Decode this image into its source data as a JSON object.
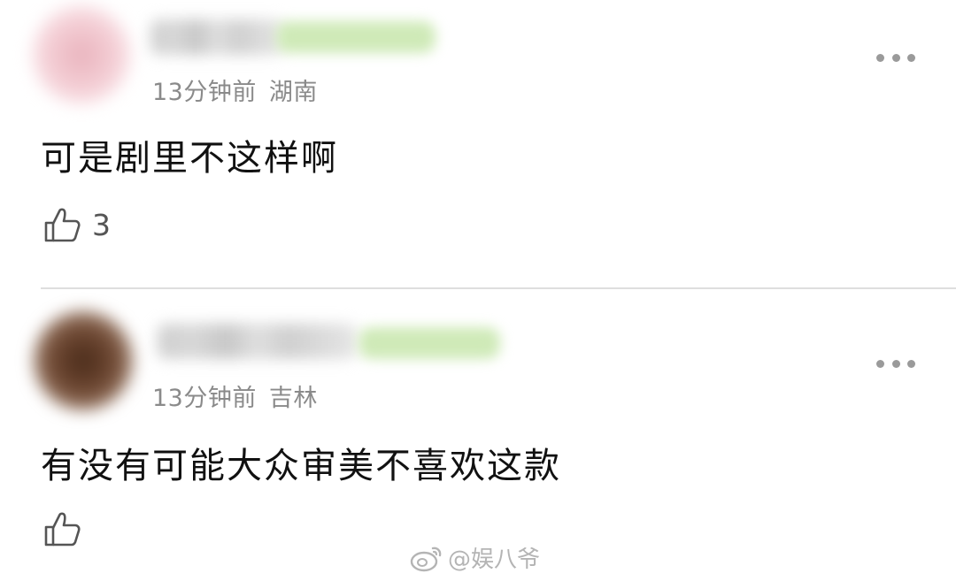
{
  "comments": [
    {
      "meta_time": "13分钟前",
      "meta_location": "湖南",
      "text": "可是剧里不这样啊",
      "like_count": "3"
    },
    {
      "meta_time": "13分钟前",
      "meta_location": "吉林",
      "text": "有没有可能大众审美不喜欢这款",
      "like_count": ""
    }
  ],
  "icons": {
    "more": "more-dots-icon",
    "like": "thumbs-up-icon",
    "watermark_logo": "weibo-logo-icon"
  },
  "watermark": {
    "text": "@娱八爷"
  },
  "colors": {
    "background": "#ffffff",
    "text": "#111111",
    "meta": "#8a8a8a",
    "divider": "#dedede",
    "badge_blur": "#cfeab8"
  }
}
